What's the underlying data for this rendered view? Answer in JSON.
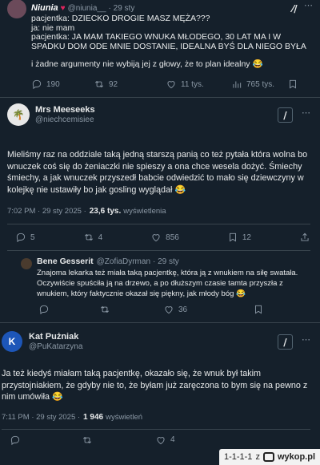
{
  "tweet1": {
    "name": "Niunia",
    "handle": "@niunia__",
    "time": "· 29 sty",
    "body": "pacjentka: DZIECKO DROGIE MASZ MĘŻA???\nja: nie mam\npacjentka: JA MAM TAKIEGO WNUKA MŁODEGO, 30 LAT MA I W SPADKU DOM ODE MNIE DOSTANIE, IDEALNA BYŚ DLA NIEGO BYŁA",
    "body2": "i żadne argumenty nie wybiją jej z głowy, że to plan idealny 😂",
    "replies": "190",
    "reposts": "92",
    "likes": "11 tys.",
    "views": "765 tys."
  },
  "tweet2": {
    "name": "Mrs Meeseeks",
    "handle": "@niechcemisiee",
    "body": "Mieliśmy raz na oddziale taką jedną starszą panią co też pytała która wolna bo wnuczek coś się do żeniaczki nie spieszy a ona chce wesela dożyć. Śmiechy śmiechy, a jak wnuczek przyszedł babcie odwiedzić to mało się dziewczyny w kolejkę nie ustawiły bo jak gosling wyglądał 😂",
    "time": "7:02 PM · 29 sty 2025 ·",
    "views_count": "23,6 tys.",
    "views_label": "wyświetlenia",
    "replies": "5",
    "reposts": "4",
    "likes": "856",
    "bookmarks": "12"
  },
  "tweet3": {
    "name": "Bene Gesserit",
    "handle": "@ZofiaDyrman",
    "time": "· 29 sty",
    "body": "Znajoma lekarka też miała taką pacjentkę, która ją z wnukiem na siłę swatała. Oczywiście spuściła ją na drzewo, a po dłuższym czasie tamta przyszła z wnukiem, który faktycznie okazał się piękny, jak młody bóg 😂",
    "likes": "36"
  },
  "tweet4": {
    "name": "Kat Pużniak",
    "handle": "@PuKatarzyna",
    "avatar_letter": "K",
    "body": "Ja też kiedyś miałam taką pacjentkę, okazało się, że wnuk był takim przystojniakiem, że gdyby nie to, że byłam już zaręczona to bym się na pewno z nim umówiła 😂",
    "time": "7:11 PM · 29 sty 2025 ·",
    "views_count": "1 946",
    "views_label": "wyświetleń",
    "replies": "",
    "reposts": "",
    "likes": "4"
  },
  "watermark": {
    "score": "1-1-1-1",
    "sep": "z",
    "site": "wykop.pl"
  },
  "colors": {
    "background": "#15202b",
    "text": "#e7e9ea",
    "muted": "#8b98a5",
    "avatar_blue": "#1d56b8"
  }
}
